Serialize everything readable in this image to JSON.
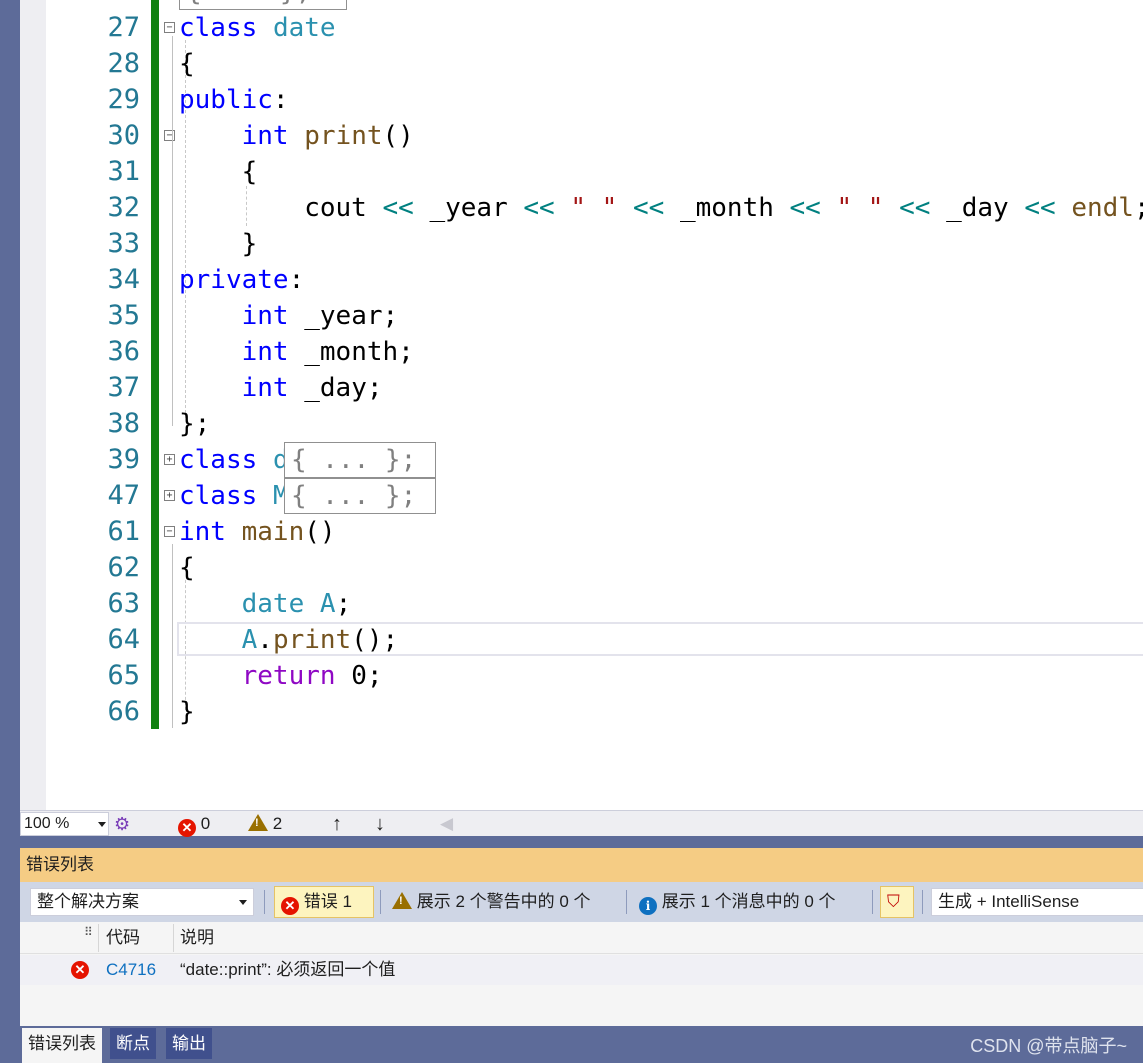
{
  "editor": {
    "lines": [
      {
        "num": "27",
        "code": "class date"
      },
      {
        "num": "28",
        "code": "{"
      },
      {
        "num": "29",
        "code": "public:"
      },
      {
        "num": "30",
        "code": "int print()"
      },
      {
        "num": "31",
        "code": "{"
      },
      {
        "num": "32",
        "code": "cout << _year << \" \" << _month << \" \" << _day << endl;"
      },
      {
        "num": "33",
        "code": "}"
      },
      {
        "num": "34",
        "code": "private:"
      },
      {
        "num": "35",
        "code": "int _year;"
      },
      {
        "num": "36",
        "code": "int _month;"
      },
      {
        "num": "37",
        "code": "int _day;"
      },
      {
        "num": "38",
        "code": "};"
      },
      {
        "num": "39",
        "code": "class d"
      },
      {
        "num": "47",
        "code": "class M"
      },
      {
        "num": "61",
        "code": "int main()"
      },
      {
        "num": "62",
        "code": "{"
      },
      {
        "num": "63",
        "code": "date A;"
      },
      {
        "num": "64",
        "code": "A.print();"
      },
      {
        "num": "65",
        "code": "return 0;"
      },
      {
        "num": "66",
        "code": "}"
      }
    ],
    "collapsed_text": "{ ... };",
    "colors": {
      "keyword": "#0000ff",
      "type": "#2b91af",
      "function": "#74531f",
      "string": "#a31515",
      "operator": "#008080",
      "control": "#8f08c4",
      "change_bar": "#108010"
    }
  },
  "statusstrip": {
    "zoom": "100 %",
    "error_count": "0",
    "warning_count": "2",
    "icons": [
      "intellicode-icon",
      "error-icon",
      "warning-icon",
      "arrow-up-icon",
      "arrow-down-icon",
      "arrow-left-icon"
    ]
  },
  "errorlist": {
    "title": "错误列表",
    "scope": "整个解决方案",
    "errors_btn": "错误 1",
    "warnings_btn": "展示 2 个警告中的 0 个",
    "messages_btn": "展示 1 个消息中的 0 个",
    "source": "生成 + IntelliSense",
    "col_code": "代码",
    "col_desc": "说明",
    "rows": [
      {
        "code": "C4716",
        "desc": "“date::print”: 必须返回一个值"
      }
    ]
  },
  "bottom_tabs": [
    "错误列表",
    "断点",
    "输出"
  ],
  "watermark": "CSDN @带点脑子~"
}
